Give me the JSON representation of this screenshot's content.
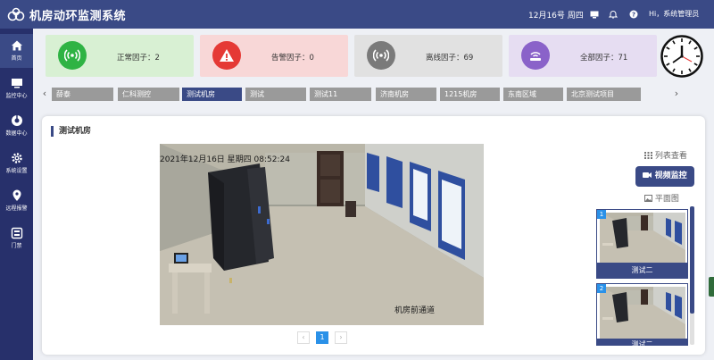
{
  "header": {
    "title": "机房动环监测系统",
    "date": "12月16号 周四",
    "user": "Hi，系统管理员",
    "icons": [
      "screen-icon",
      "bell-icon",
      "help-icon"
    ]
  },
  "sidebar": {
    "items": [
      {
        "label": "首页",
        "icon": "home-icon"
      },
      {
        "label": "监控中心",
        "icon": "monitor-icon"
      },
      {
        "label": "数据中心",
        "icon": "data-icon"
      },
      {
        "label": "系统设置",
        "icon": "gear-icon"
      },
      {
        "label": "远程报警",
        "icon": "location-icon"
      },
      {
        "label": "门禁",
        "icon": "door-icon"
      }
    ]
  },
  "stats": [
    {
      "label": "正常因子：2",
      "icon": "signal-icon",
      "bg": "#d8f0d3",
      "badge": "#2fb344"
    },
    {
      "label": "告警因子：0",
      "icon": "warning-icon",
      "bg": "#f8d7d7",
      "badge": "#e53935"
    },
    {
      "label": "离线因子：69",
      "icon": "offline-icon",
      "bg": "#e1e1e1",
      "badge": "#7a7a7a"
    },
    {
      "label": "全部因子：71",
      "icon": "all-icon",
      "bg": "#e6ddf2",
      "badge": "#8a62c9"
    }
  ],
  "tabs": [
    "薛泰",
    "仁科测控",
    "测试机房",
    "测试",
    "测试11",
    "济南机房",
    "1215机房",
    "东南区域",
    "北京测试项目"
  ],
  "active_tab": "测试机房",
  "panel": {
    "title": "测试机房",
    "video_timestamp": "2021年12月16日 星期四 08:52:24",
    "camera_name": "机房前通道"
  },
  "pagination": {
    "prev": "‹",
    "current": "1",
    "next": "›"
  },
  "views": {
    "list": "列表查看",
    "video": "视频监控",
    "floor": "平面图"
  },
  "thumbnails": [
    {
      "num": "1",
      "label": "测试二"
    },
    {
      "num": "2",
      "label": "测试二"
    }
  ],
  "colors": {
    "primary": "#3a4a86",
    "sidebar": "#27306b",
    "accent": "#2a91e8"
  }
}
